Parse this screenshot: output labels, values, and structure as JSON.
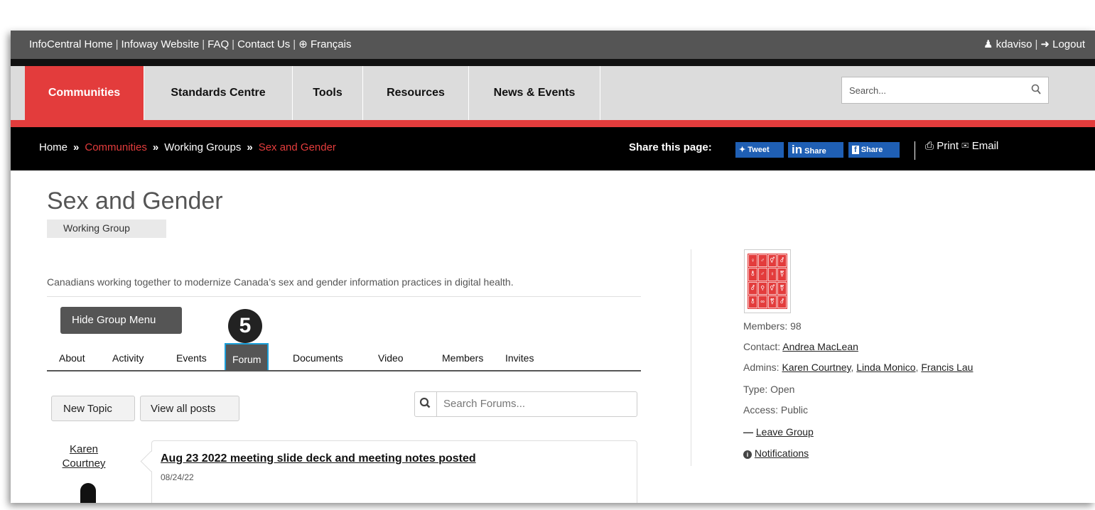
{
  "topbar": {
    "links": [
      "InfoCentral Home",
      "Infoway Website",
      "FAQ",
      "Contact Us",
      "Français"
    ],
    "user": "kdaviso",
    "logout": "Logout"
  },
  "nav": {
    "items": [
      "Communities",
      "Standards Centre",
      "Tools",
      "Resources",
      "News & Events"
    ],
    "search_placeholder": "Search..."
  },
  "breadcrumb": {
    "home": "Home",
    "communities": "Communities",
    "working_groups": "Working Groups",
    "current": "Sex and Gender"
  },
  "share": {
    "label": "Share this page:",
    "tweet": "Tweet",
    "linkedin": "Share",
    "facebook": "Share",
    "print": "Print",
    "email": "Email"
  },
  "group": {
    "title": "Sex and Gender",
    "type_badge": "Working Group",
    "description": "Canadians working together to modernize Canada’s sex and gender information practices in digital health.",
    "hide_menu": "Hide Group Menu",
    "step_number": "5",
    "tabs": [
      "About",
      "Activity",
      "Events",
      "Forum",
      "Documents",
      "Video",
      "Members",
      "Invites"
    ],
    "active_tab": "Forum"
  },
  "forum": {
    "new_topic": "New Topic",
    "view_all": "View all posts",
    "search_placeholder": "Search Forums...",
    "post": {
      "author_first": "Karen",
      "author_last": "Courtney",
      "title": "Aug 23 2022 meeting slide deck and meeting notes posted",
      "date": "08/24/22"
    }
  },
  "sidebar": {
    "members_label": "Members:",
    "members_count": "98",
    "contact_label": "Contact:",
    "contact": "Andrea MacLean",
    "admins_label": "Admins:",
    "admins": [
      "Karen Courtney",
      "Linda Monico",
      "Francis Lau"
    ],
    "type_label": "Type:",
    "type": "Open",
    "access_label": "Access:",
    "access": "Public",
    "leave": "Leave Group",
    "notifications": "Notifications"
  },
  "colors": {
    "brand_red": "#e33c3c",
    "topbar_gray": "#555555",
    "nav_gray": "#dcdcdc",
    "share_blue": "#1f5fb4"
  }
}
